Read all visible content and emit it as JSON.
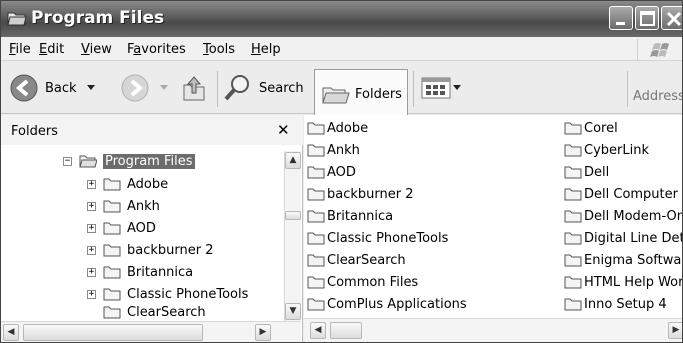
{
  "window": {
    "title": "Program Files"
  },
  "menu": [
    {
      "pre": "",
      "key": "F",
      "post": "ile"
    },
    {
      "pre": "",
      "key": "E",
      "post": "dit"
    },
    {
      "pre": "",
      "key": "V",
      "post": "iew"
    },
    {
      "pre": "F",
      "key": "a",
      "post": "vorites"
    },
    {
      "pre": "",
      "key": "T",
      "post": "ools"
    },
    {
      "pre": "",
      "key": "H",
      "post": "elp"
    }
  ],
  "toolbar": {
    "back_label": "Back",
    "search_label": "Search",
    "folders_label": "Folders",
    "address_label": "Address"
  },
  "folders_pane": {
    "header": "Folders",
    "close_glyph": "✕",
    "root": "Program Files",
    "children": [
      "Adobe",
      "Ankh",
      "AOD",
      "backburner 2",
      "Britannica",
      "Classic PhoneTools",
      "ClearSearch"
    ]
  },
  "content": {
    "col1": [
      "Adobe",
      "Ankh",
      "AOD",
      "backburner 2",
      "Britannica",
      "Classic PhoneTools",
      "ClearSearch",
      "Common Files",
      "ComPlus Applications"
    ],
    "col2": [
      "Corel",
      "CyberLink",
      "Dell",
      "Dell Computer",
      "Dell Modem-On-",
      "Digital Line Dete",
      "Enigma Softwar",
      "HTML Help Work",
      "Inno Setup 4"
    ]
  },
  "colors": {
    "selected_bg": "#6c6c6c",
    "title_bar": "#5c5c5c",
    "folder_fill": "#f4f4f4"
  }
}
